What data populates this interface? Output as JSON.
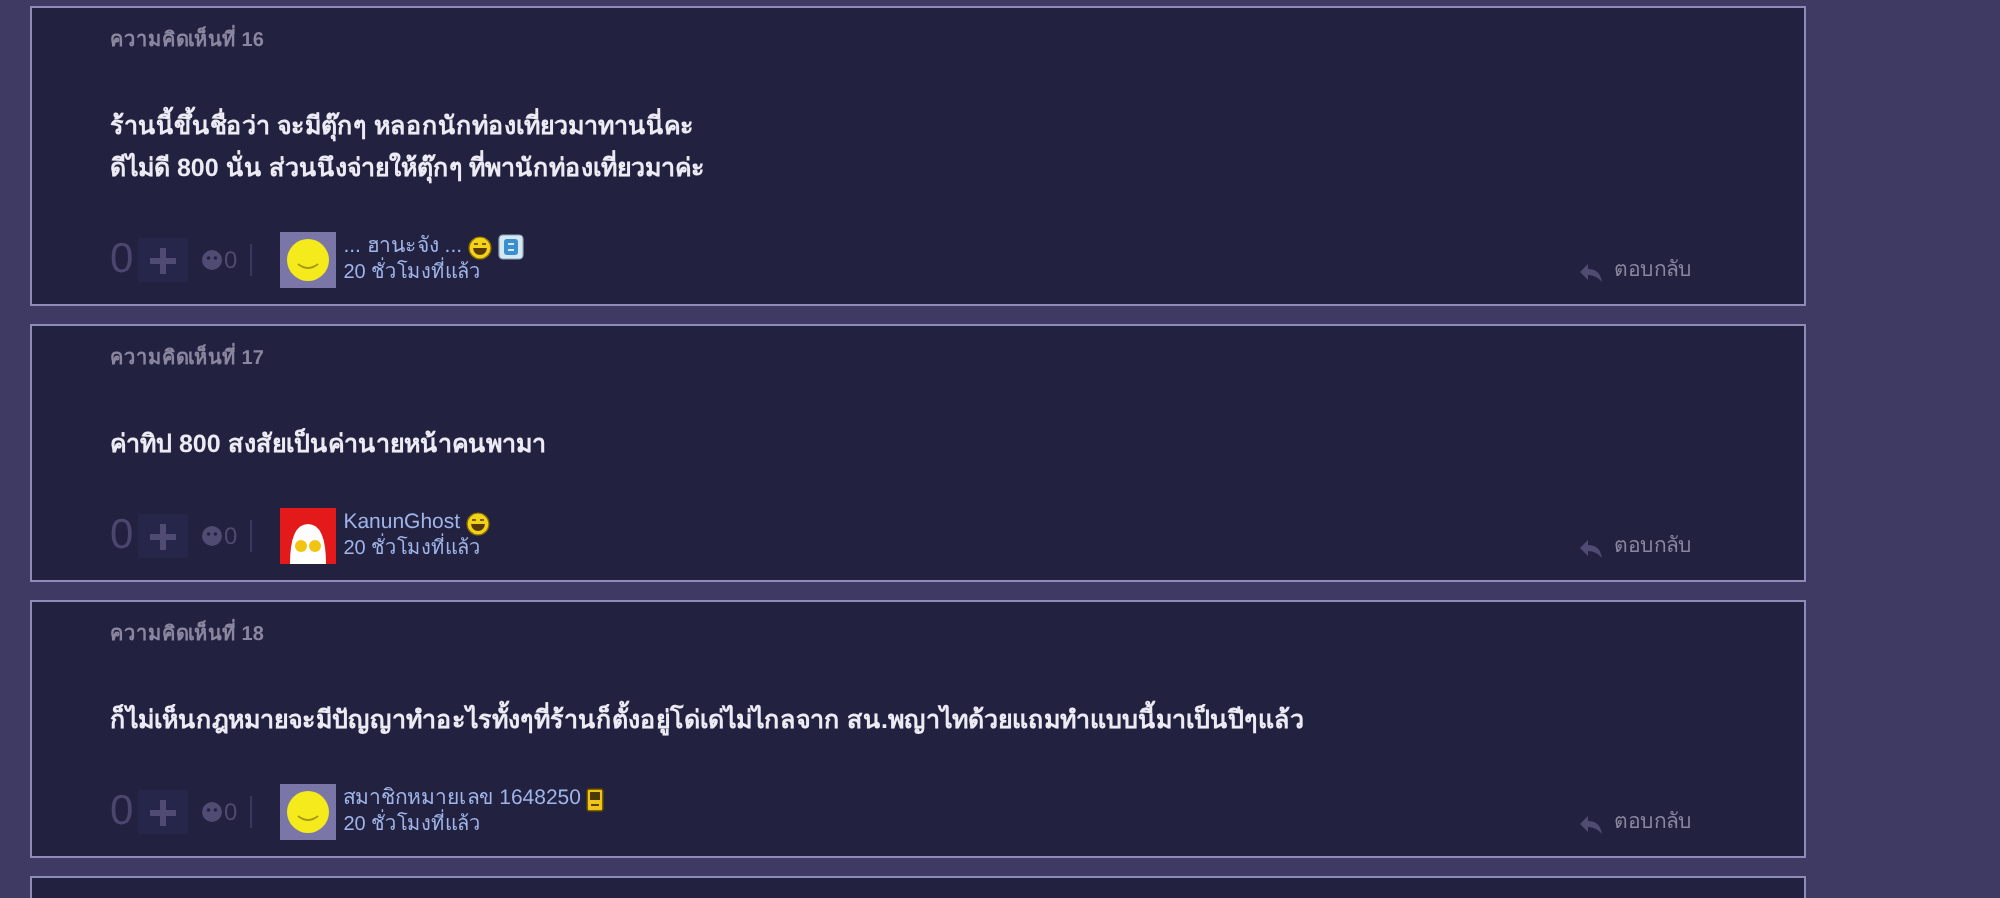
{
  "comments": [
    {
      "label": "ความคิดเห็นที่ 16",
      "body": [
        "ร้านนี้ขึ้นชื่อว่า จะมีตุ๊กๆ หลอกนักท่องเที่ยวมาทานนี่คะ",
        "ดีไม่ดี 800 นั่น ส่วนนึงจ่ายให้ตุ๊กๆ ที่พานักท่องเที่ยวมาค่ะ"
      ],
      "score": "0",
      "dislikes": "0",
      "user": {
        "name": "... ฮานะจัง ...",
        "avatar": {
          "kind": "smiley"
        },
        "badges": [
          {
            "kind": "laugh"
          },
          {
            "kind": "blog"
          }
        ]
      },
      "time": "20 ชั่วโมงที่แล้ว",
      "reply": "ตอบกลับ"
    },
    {
      "label": "ความคิดเห็นที่ 17",
      "body": [
        "ค่าทิป 800 สงสัยเป็นค่านายหน้าคนพามา"
      ],
      "score": "0",
      "dislikes": "0",
      "user": {
        "name": "KanunGhost",
        "avatar": {
          "kind": "red"
        },
        "badges": [
          {
            "kind": "laugh"
          }
        ]
      },
      "time": "20 ชั่วโมงที่แล้ว",
      "reply": "ตอบกลับ"
    },
    {
      "label": "ความคิดเห็นที่ 18",
      "body": [
        "ก็ไม่เห็นกฎหมายจะมีปัญญาทำอะไรทั้งๆที่ร้านก็ตั้งอยู่โด่เด่ไม่ไกลจาก สน.พญาไทด้วยแถมทำแบบนี้มาเป็นปีๆแล้ว"
      ],
      "score": "0",
      "dislikes": "0",
      "user": {
        "name": "สมาชิกหมายเลข 1648250",
        "avatar": {
          "kind": "smiley"
        },
        "badges": [
          {
            "kind": "phone"
          }
        ]
      },
      "time": "20 ชั่วโมงที่แล้ว",
      "reply": "ตอบกลับ"
    }
  ]
}
